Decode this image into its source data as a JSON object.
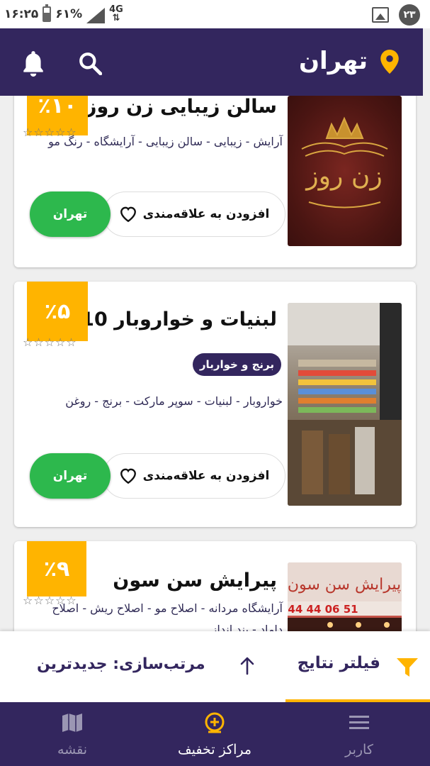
{
  "status": {
    "time": "۱۶:۲۵",
    "battery": "۶۱%",
    "network": "4G",
    "notification_count": "۲۳"
  },
  "header": {
    "city": "تهران"
  },
  "cards": [
    {
      "title": "سالن زیبایی زن روز",
      "discount": "٪۱۰",
      "stars": "☆☆☆☆☆",
      "tags": "آرایش  -  زیبایی  -  سالن زیبایی  -  آرایشگاه  -  رنگ مو",
      "photo_text": "زن روز",
      "fav_label": "افزودن به علاقه‌مندی",
      "city_label": "تهران"
    },
    {
      "title": "لبنیات و خواروبار 110",
      "discount": "٪۵",
      "stars": "☆☆☆☆☆",
      "category": "برنج و خواربار",
      "tags": "خواروبار  -  لبنیات  -  سوپر مارکت  -  برنج  -  روغن",
      "fav_label": "افزودن به علاقه‌مندی",
      "city_label": "تهران"
    },
    {
      "title": "پیرایش سن سون",
      "discount": "٪۹",
      "stars": "☆☆☆☆☆",
      "tags": "آرایشگاه مردانه  -  اصلاح مو  -  اصلاح ریش  -  اصلاح داماد  -  بند انداز",
      "photo_text": "پیرایش سن سون",
      "photo_phone": "44 44 06 51"
    }
  ],
  "filter": {
    "filter_label": "فیلتر نتایج",
    "sort_label": "مرتب‌سازی: جدیدترین"
  },
  "nav": {
    "user_label": "کاربر",
    "discounts_label": "مراکز تخفیف",
    "map_label": "نقشه"
  },
  "colors": {
    "primary": "#33265e",
    "accent": "#ffb400",
    "green": "#2db84d"
  }
}
